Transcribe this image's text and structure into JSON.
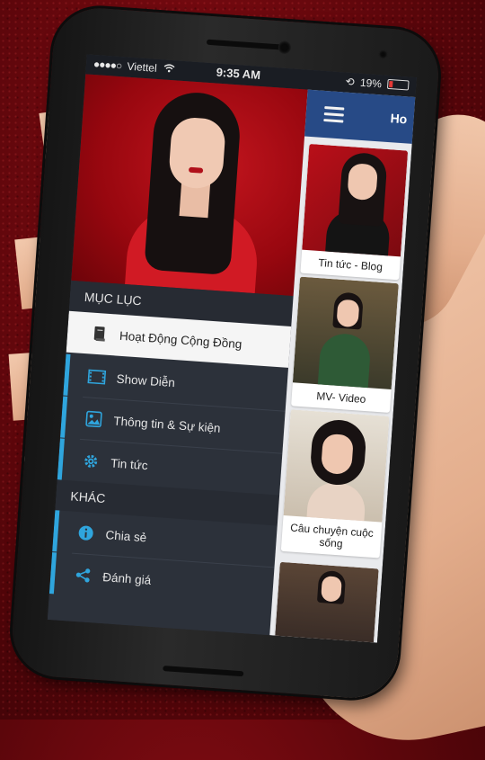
{
  "status_bar": {
    "carrier": "Viettel",
    "time": "9:35 AM",
    "battery": "19%"
  },
  "drawer": {
    "section_main": "MỤC LỤC",
    "items_main": [
      {
        "label": "Hoạt Động Cộng Đồng",
        "icon": "book-icon",
        "active": true
      },
      {
        "label": "Show Diễn",
        "icon": "film-icon"
      },
      {
        "label": "Thông tin & Sự kiện",
        "icon": "image-icon"
      },
      {
        "label": "Tin tức",
        "icon": "gear-icon"
      }
    ],
    "section_other": "KHÁC",
    "items_other": [
      {
        "label": "Chia sẻ",
        "icon": "info-icon"
      },
      {
        "label": "Đánh giá",
        "icon": "share-icon"
      }
    ]
  },
  "content": {
    "title": "Ho",
    "cards": [
      {
        "caption": "Tin tức - Blog"
      },
      {
        "caption": "MV- Video"
      },
      {
        "caption": "Câu chuyện cuộc sống"
      },
      {
        "caption": ""
      }
    ]
  },
  "colors": {
    "accent": "#2fa5dd",
    "topbar": "#274a86",
    "drawer_bg": "#2c313a",
    "background": "#7a0a10"
  }
}
